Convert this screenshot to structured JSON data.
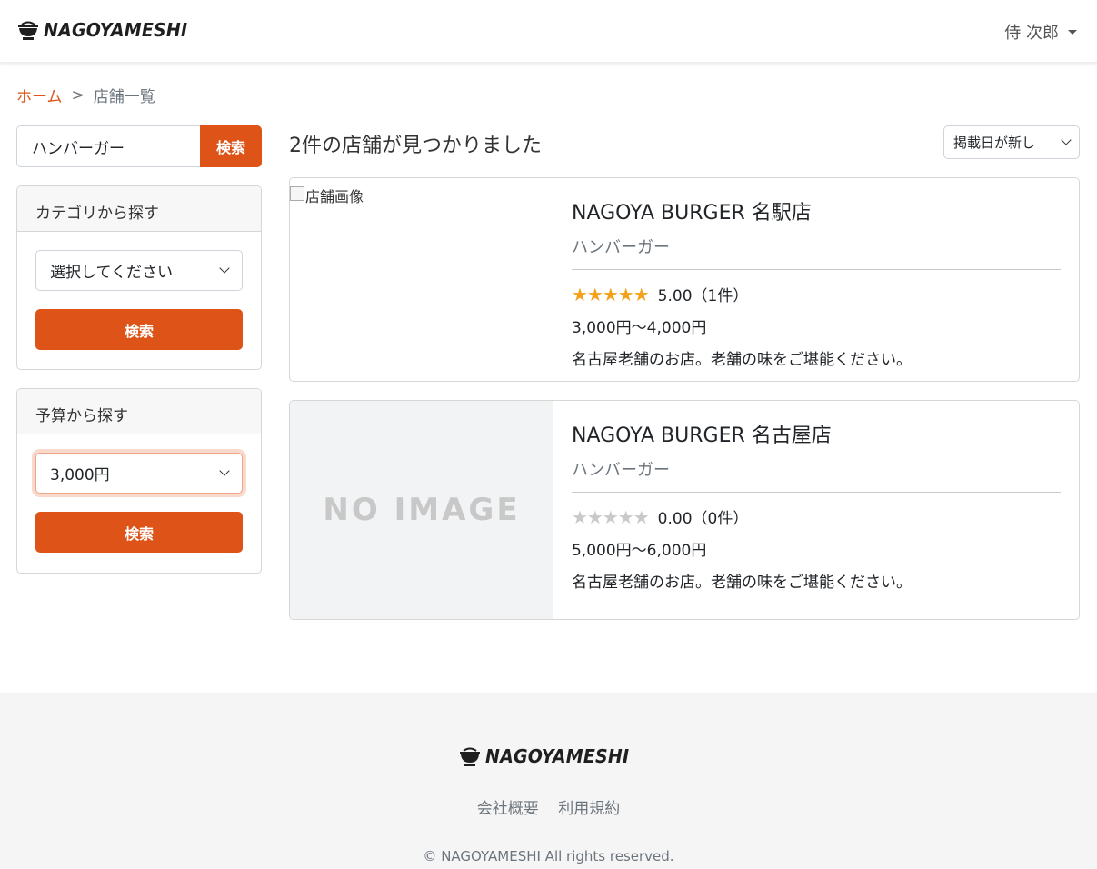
{
  "header": {
    "brand": "NAGOYAMESHI",
    "user_name": "侍 次郎"
  },
  "breadcrumb": {
    "home": "ホーム",
    "separator": ">",
    "current": "店舗一覧"
  },
  "sidebar": {
    "keyword_value": "ハンバーガー",
    "keyword_button": "検索",
    "category": {
      "title": "カテゴリから探す",
      "selected": "選択してください",
      "button": "検索"
    },
    "budget": {
      "title": "予算から探す",
      "selected": "3,000円",
      "button": "検索"
    }
  },
  "results": {
    "summary": "2件の店舗が見つかりました",
    "sort_selected": "掲載日が新し",
    "shops": [
      {
        "image_alt": "店舗画像",
        "name": "NAGOYA BURGER 名駅店",
        "category": "ハンバーガー",
        "stars": "★★★★★",
        "rating": 5.0,
        "rating_text": "5.00（1件）",
        "price": "3,000円〜4,000円",
        "description": "名古屋老舗のお店。老舗の味をご堪能ください。"
      },
      {
        "image_text": "NO IMAGE",
        "name": "NAGOYA BURGER 名古屋店",
        "category": "ハンバーガー",
        "stars": "★★★★★",
        "rating": 0.0,
        "rating_text": "0.00（0件）",
        "price": "5,000円〜6,000円",
        "description": "名古屋老舗のお店。老舗の味をご堪能ください。"
      }
    ]
  },
  "footer": {
    "brand": "NAGOYAMESHI",
    "links": [
      "会社概要",
      "利用規約"
    ],
    "copyright": "© NAGOYAMESHI All rights reserved."
  },
  "colors": {
    "accent": "#dd5318",
    "star": "#f3a11b"
  }
}
